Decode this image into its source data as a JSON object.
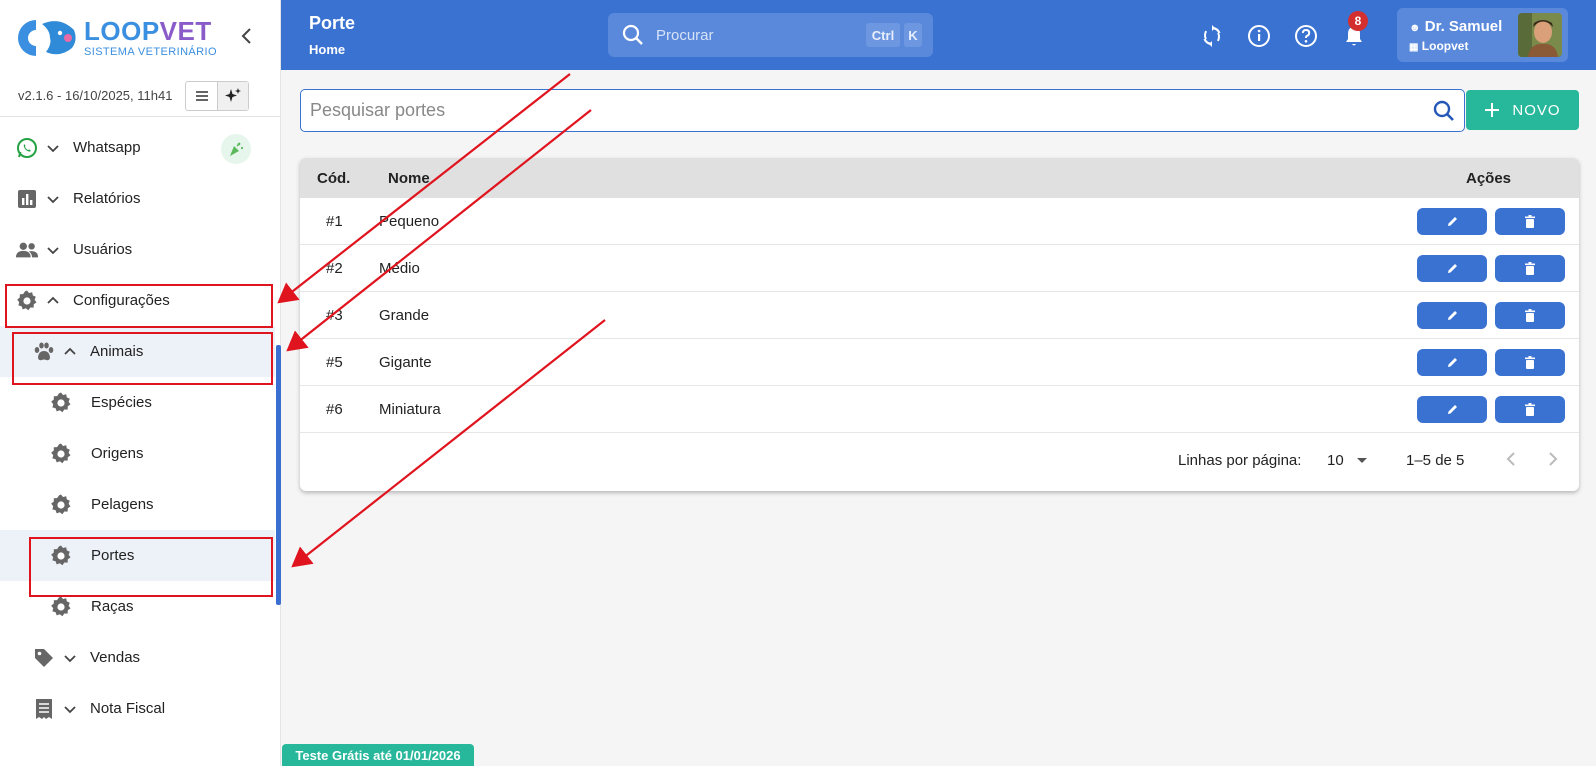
{
  "brand": {
    "name_part1": "LOOP",
    "name_part2": "VET",
    "subtitle": "SISTEMA VETERINÁRIO"
  },
  "sidebar": {
    "version": "v2.1.6 - 16/10/2025, 11h41",
    "items": [
      {
        "label": "Whatsapp",
        "icon": "whatsapp-icon"
      },
      {
        "label": "Relatórios",
        "icon": "bar-chart-icon"
      },
      {
        "label": "Usuários",
        "icon": "users-icon"
      },
      {
        "label": "Configurações",
        "icon": "gear-icon"
      },
      {
        "label": "Animais",
        "icon": "paw-icon"
      },
      {
        "label": "Espécies",
        "icon": "gear-icon"
      },
      {
        "label": "Origens",
        "icon": "gear-icon"
      },
      {
        "label": "Pelagens",
        "icon": "gear-icon"
      },
      {
        "label": "Portes",
        "icon": "gear-icon"
      },
      {
        "label": "Raças",
        "icon": "gear-icon"
      },
      {
        "label": "Vendas",
        "icon": "tag-icon"
      },
      {
        "label": "Nota Fiscal",
        "icon": "receipt-icon"
      }
    ]
  },
  "header": {
    "title": "Porte",
    "breadcrumb": "Home",
    "search_placeholder": "Procurar",
    "shortcut_ctrl": "Ctrl",
    "shortcut_key": "K",
    "notification_count": "8",
    "user_name": "Dr. Samuel",
    "user_org": "Loopvet"
  },
  "main": {
    "filter_placeholder": "Pesquisar portes",
    "new_button": "NOVO",
    "columns": {
      "code": "Cód.",
      "name": "Nome",
      "actions": "Ações"
    },
    "rows": [
      {
        "code": "#1",
        "name": "Pequeno"
      },
      {
        "code": "#2",
        "name": "Médio"
      },
      {
        "code": "#3",
        "name": "Grande"
      },
      {
        "code": "#5",
        "name": "Gigante"
      },
      {
        "code": "#6",
        "name": "Miniatura"
      }
    ],
    "pagination": {
      "rows_label": "Linhas por página:",
      "rows_value": "10",
      "range": "1–5 de 5"
    }
  },
  "trial_banner": "Teste Grátis até 01/01/2026",
  "colors": {
    "primary": "#3a72d2",
    "accent": "#27b79a",
    "annotation": "#e0141e"
  }
}
